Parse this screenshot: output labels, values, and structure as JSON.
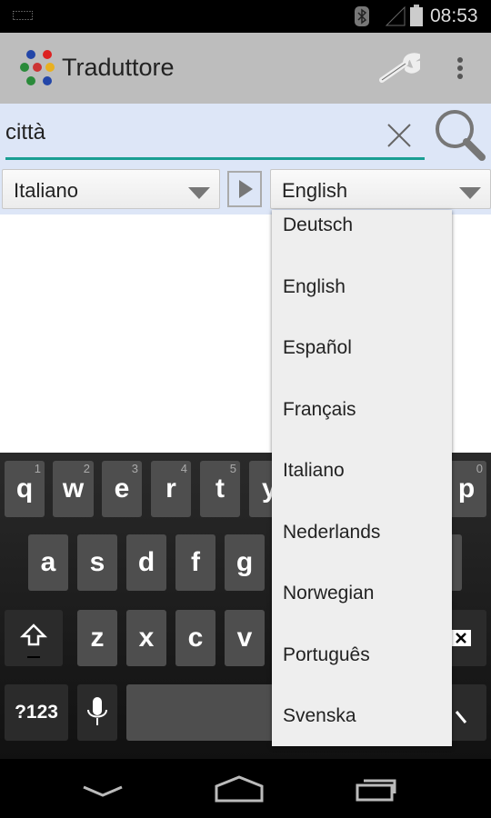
{
  "status": {
    "time": "08:53",
    "icons": [
      "keyboard-icon",
      "bluetooth-icon",
      "signal-icon",
      "battery-icon"
    ]
  },
  "appbar": {
    "title": "Traduttore",
    "icons": [
      "flags-logo-icon",
      "wrench-icon",
      "overflow-menu-icon"
    ]
  },
  "search": {
    "value": "città",
    "clear_icon": "close-icon",
    "search_icon": "search-icon",
    "underline_color": "#1a9e93"
  },
  "languages": {
    "source": "Italiano",
    "target": "English",
    "swap_icon": "play-arrow-icon"
  },
  "dropdown": {
    "items": [
      "Deutsch",
      "English",
      "Español",
      "Français",
      "Italiano",
      "Nederlands",
      "Norwegian",
      "Português",
      "Svenska"
    ]
  },
  "keyboard": {
    "row1": [
      {
        "k": "q",
        "n": "1"
      },
      {
        "k": "w",
        "n": "2"
      },
      {
        "k": "e",
        "n": "3"
      },
      {
        "k": "r",
        "n": "4"
      },
      {
        "k": "t",
        "n": "5"
      },
      {
        "k": "y",
        "n": ""
      },
      {
        "k": "p",
        "n": "0"
      }
    ],
    "row2": [
      "a",
      "s",
      "d",
      "f",
      "g"
    ],
    "row3": [
      "z",
      "x",
      "c",
      "v"
    ],
    "symbols": "?123"
  },
  "nav": {
    "icons": [
      "back-icon",
      "home-icon",
      "recents-icon"
    ]
  }
}
